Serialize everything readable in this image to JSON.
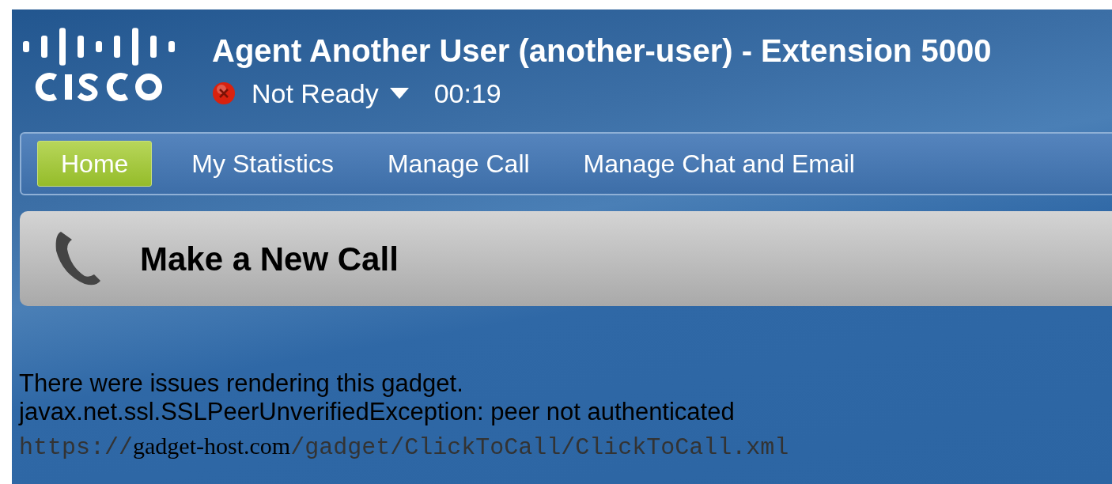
{
  "header": {
    "title": "Agent Another User (another-user) - Extension 5000",
    "status": {
      "label": "Not Ready",
      "ready": false,
      "timer": "00:19"
    }
  },
  "tabs": [
    {
      "label": "Home",
      "selected": true
    },
    {
      "label": "My Statistics",
      "selected": false
    },
    {
      "label": "Manage Call",
      "selected": false
    },
    {
      "label": "Manage Chat and Email",
      "selected": false
    }
  ],
  "gadget": {
    "title": "Make a New Call",
    "error_lines": [
      "There were issues rendering this gadget.",
      "javax.net.ssl.SSLPeerUnverifiedException: peer not authenticated"
    ],
    "url": {
      "scheme": "https://",
      "host": "gadget-host.com",
      "path": "/gadget/ClickToCall/ClickToCall.xml"
    }
  }
}
